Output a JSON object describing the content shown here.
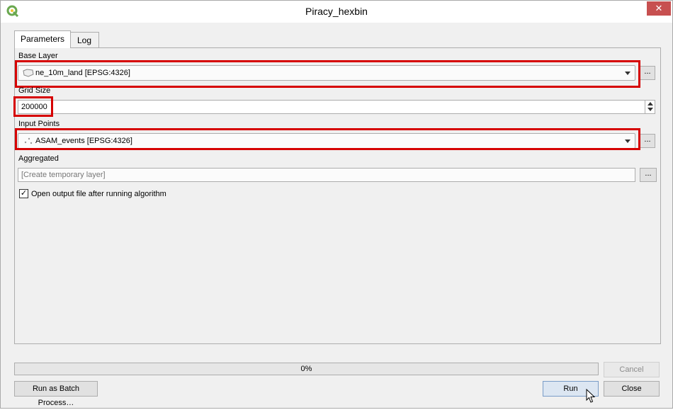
{
  "window": {
    "title": "Piracy_hexbin",
    "close_glyph": "✕"
  },
  "tabs": [
    {
      "label": "Parameters",
      "active": true
    },
    {
      "label": "Log",
      "active": false
    }
  ],
  "params": {
    "base_layer": {
      "label": "Base Layer",
      "value": "ne_10m_land [EPSG:4326]",
      "icon": "polygon-layer-icon",
      "more": "..."
    },
    "grid_size": {
      "label": "Grid Size",
      "value": "200000"
    },
    "input_points": {
      "label": "Input Points",
      "value": "ASAM_events [EPSG:4326]",
      "icon": "point-layer-icon",
      "more": "..."
    },
    "aggregated": {
      "label": "Aggregated",
      "placeholder": "[Create temporary layer]",
      "more": "..."
    },
    "open_output": {
      "label": "Open output file after running algorithm",
      "checked": true,
      "check_glyph": "✓"
    }
  },
  "progress": {
    "value": 0,
    "text": "0%"
  },
  "buttons": {
    "cancel": "Cancel",
    "batch": "Run as Batch Process…",
    "run": "Run",
    "close": "Close"
  },
  "colors": {
    "highlight": "#d60000",
    "qgis_green": "#6aa84f",
    "close_red": "#c75050"
  }
}
